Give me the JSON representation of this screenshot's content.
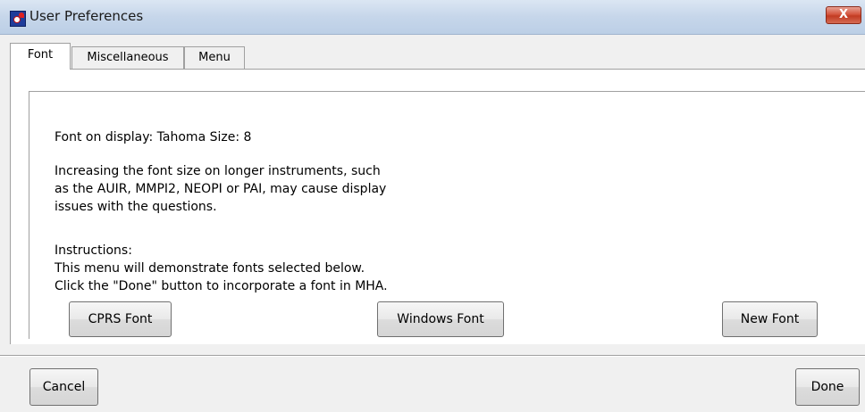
{
  "window": {
    "title": "User Preferences",
    "close_label": "X"
  },
  "tabs": [
    {
      "label": "Font",
      "active": true
    },
    {
      "label": "Miscellaneous",
      "active": false
    },
    {
      "label": "Menu",
      "active": false
    }
  ],
  "font_tab": {
    "font_on_display": "Font on display: Tahoma   Size: 8",
    "warning_lines": [
      "Increasing the font size on longer instruments, such",
      "as the AUIR, MMPI2, NEOPI or PAI, may cause display",
      "issues with the questions."
    ],
    "instructions_lines": [
      "Instructions:",
      "This menu will demonstrate fonts selected below.",
      "Click the \"Done\" button to incorporate a font in MHA."
    ],
    "buttons": {
      "cprs_font": "CPRS Font",
      "windows_font": "Windows Font",
      "new_font": "New Font"
    }
  },
  "footer": {
    "cancel": "Cancel",
    "done": "Done"
  },
  "colors": {
    "titlebar": "#c6d6ea",
    "close_button": "#c23b22",
    "dialog_background": "#f0f0f0",
    "panel_background": "#ffffff"
  }
}
